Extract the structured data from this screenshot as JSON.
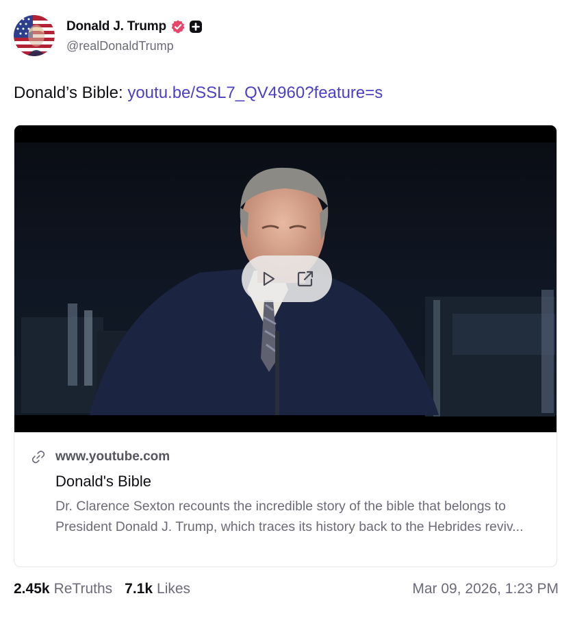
{
  "author": {
    "display_name": "Donald J. Trump",
    "handle": "@realDonaldTrump",
    "avatar_icon": "portrait-flag-avatar",
    "verified_icon": "verified-badge-icon",
    "plus_icon": "plus-square-icon"
  },
  "post": {
    "text_prefix": "Donald’s Bible: ",
    "link_text": "youtu.be/SSL7_QV4960?feature=s"
  },
  "card": {
    "domain": "www.youtube.com",
    "title": "Donald's Bible",
    "description": "Dr. Clarence Sexton recounts the incredible story of the bible that belongs to President Donald J. Trump, which traces its history back to the Hebrides reviv...",
    "controls": {
      "play_icon": "play-icon",
      "external_icon": "external-link-icon"
    }
  },
  "stats": {
    "retruths_count": "2.45k",
    "retruths_label": "ReTruths",
    "likes_count": "7.1k",
    "likes_label": "Likes",
    "timestamp": "Mar 09, 2026, 1:23 PM"
  },
  "colors": {
    "link": "#4a3fc7",
    "verified": "#e8456b",
    "muted_text": "#6b6b78"
  }
}
